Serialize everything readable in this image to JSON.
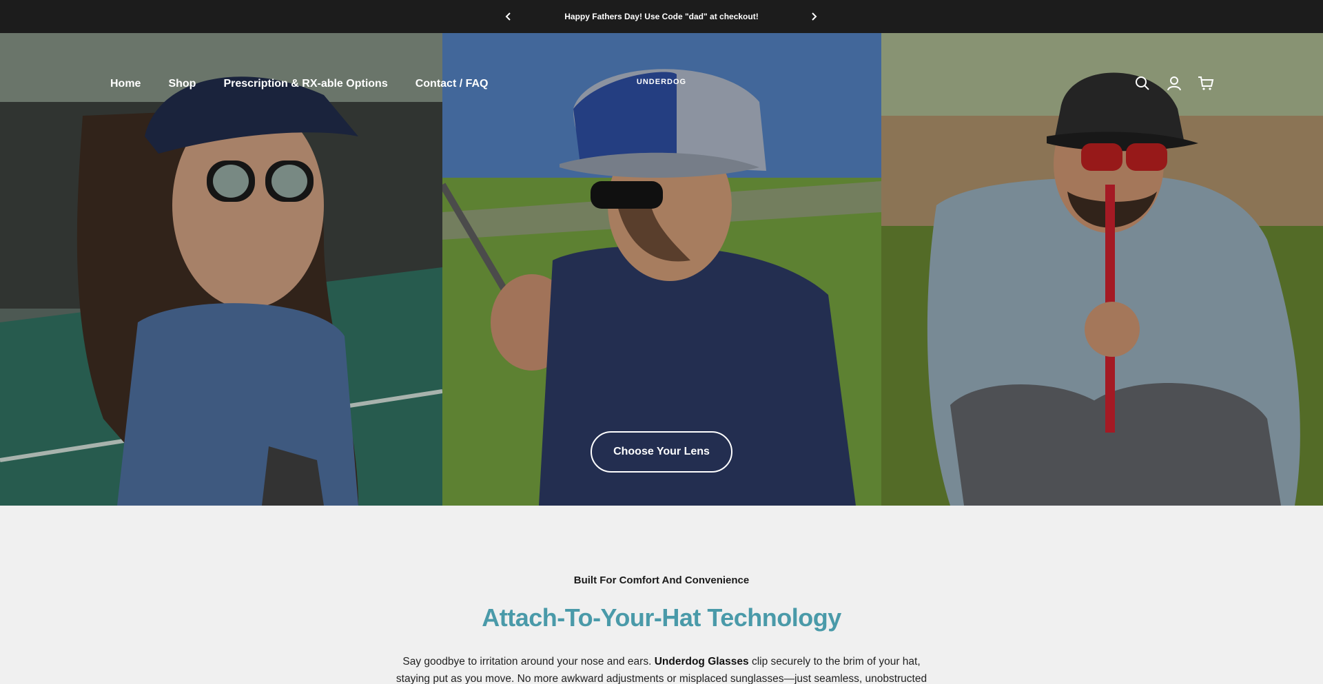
{
  "announcement": {
    "message": "Happy Fathers Day! Use Code \"dad\" at checkout!",
    "prev_icon": "chevron-left-icon",
    "next_icon": "chevron-right-icon"
  },
  "nav": {
    "links": [
      "Home",
      "Shop",
      "Prescription & RX-able Options",
      "Contact / FAQ"
    ],
    "logo": "UNDERDOG",
    "icons": [
      "search-icon",
      "account-icon",
      "cart-icon"
    ]
  },
  "hero": {
    "cta_label": "Choose Your Lens"
  },
  "feature": {
    "eyebrow": "Built For Comfort And Convenience",
    "headline": "Attach-To-Your-Hat Technology",
    "body_prefix": "Say goodbye to irritation around your nose and ears. ",
    "body_brand": "Underdog Glasses",
    "body_suffix": " clip securely to the brim of your hat, staying put as you move. No more awkward adjustments or misplaced sunglasses—just seamless, unobstructed"
  },
  "colors": {
    "announcement_bg": "#1c1c1c",
    "page_bg": "#f0f0f0",
    "headline": "#4a9aa9"
  }
}
